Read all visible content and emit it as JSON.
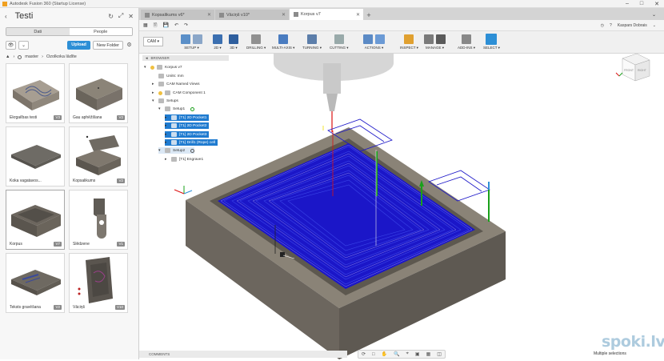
{
  "window": {
    "title": "Autodesk Fusion 360 (Startup License)",
    "controls": [
      "–",
      "□",
      "✕"
    ]
  },
  "data_panel": {
    "project_title": "Testi",
    "tabs": [
      {
        "label": "Dati",
        "active": true
      },
      {
        "label": "People",
        "active": false
      }
    ],
    "upload_label": "Upload",
    "new_folder_label": "New Folder",
    "breadcrumb": [
      "master",
      "Ozolkoka lādīte"
    ],
    "items": [
      {
        "name": "Ekrgaiības testi",
        "version": "V3"
      },
      {
        "name": "Gau aphēžšlana",
        "version": "V2"
      },
      {
        "name": "Koka vagatavos...",
        "version": ""
      },
      {
        "name": "Kopsalikums",
        "version": "V2"
      },
      {
        "name": "Korpus",
        "version": "V7"
      },
      {
        "name": "Slēdzene",
        "version": "V1"
      },
      {
        "name": "Teksts gravēšana",
        "version": "V2"
      },
      {
        "name": "Vāciņš",
        "version": "V10"
      }
    ]
  },
  "doc_tabs": [
    {
      "label": "Kopsalikums v6*",
      "active": false
    },
    {
      "label": "Vāciņš v10*",
      "active": false
    },
    {
      "label": "Korpus v7",
      "active": true
    }
  ],
  "user": {
    "name": "Kaspars Dobrais"
  },
  "ribbon": {
    "workspace": "CAM ▾",
    "groups": [
      "SETUP ▾",
      "2D ▾",
      "3D ▾",
      "DRILLING ▾",
      "MULTI-AXIS ▾",
      "TURNING ▾",
      "CUTTING ▾",
      "ACTIONS ▾",
      "INSPECT ▾",
      "MANAGE ▾",
      "ADD-INS ▾",
      "SELECT ▾"
    ]
  },
  "browser": {
    "header": "BROWSER",
    "nodes": [
      {
        "label": "Korpus v7",
        "level": 0,
        "highlight": false
      },
      {
        "label": "Units: mm",
        "level": 1,
        "highlight": false
      },
      {
        "label": "CAM Named Views",
        "level": 1,
        "highlight": false
      },
      {
        "label": "CAM Component 1",
        "level": 1,
        "highlight": false
      },
      {
        "label": "Setups",
        "level": 1,
        "highlight": false
      },
      {
        "label": "Setup1",
        "level": 2,
        "highlight": false
      },
      {
        "label": "[T1] 2D Pocket1",
        "level": 3,
        "highlight": true
      },
      {
        "label": "[T1] 2D Pocket2",
        "level": 3,
        "highlight": true
      },
      {
        "label": "[T1] 2D Pocket3",
        "level": 3,
        "highlight": true
      },
      {
        "label": "[T1] Drill1 (Rope) cell",
        "level": 3,
        "highlight": true
      },
      {
        "label": "Setup2",
        "level": 2,
        "highlight": false
      },
      {
        "label": "[T1] Engrave1",
        "level": 3,
        "highlight": false
      }
    ]
  },
  "comments_label": "COMMENTS",
  "status_text": "Multiple selections",
  "watermark": "spoki.lv",
  "viewcube": {
    "front": "FRONT",
    "right": "RIGHT"
  }
}
